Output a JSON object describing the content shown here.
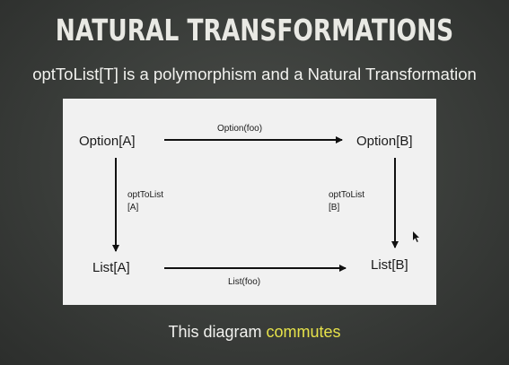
{
  "slide": {
    "title": "NATURAL TRANSFORMATIONS",
    "subtitle": "optToList[T] is a polymorphism and a Natural Transformation",
    "caption_prefix": "This diagram ",
    "caption_highlight": "commutes",
    "highlight_color": "#e6e24a"
  },
  "diagram": {
    "nodes": {
      "top_left": "Option[A]",
      "top_right": "Option[B]",
      "bottom_left": "List[A]",
      "bottom_right": "List[B]"
    },
    "edges": {
      "top": "Option(foo)",
      "bottom": "List(foo)",
      "left_line1": "optToList",
      "left_line2": "[A]",
      "right_line1": "optToList",
      "right_line2": "[B]"
    }
  }
}
